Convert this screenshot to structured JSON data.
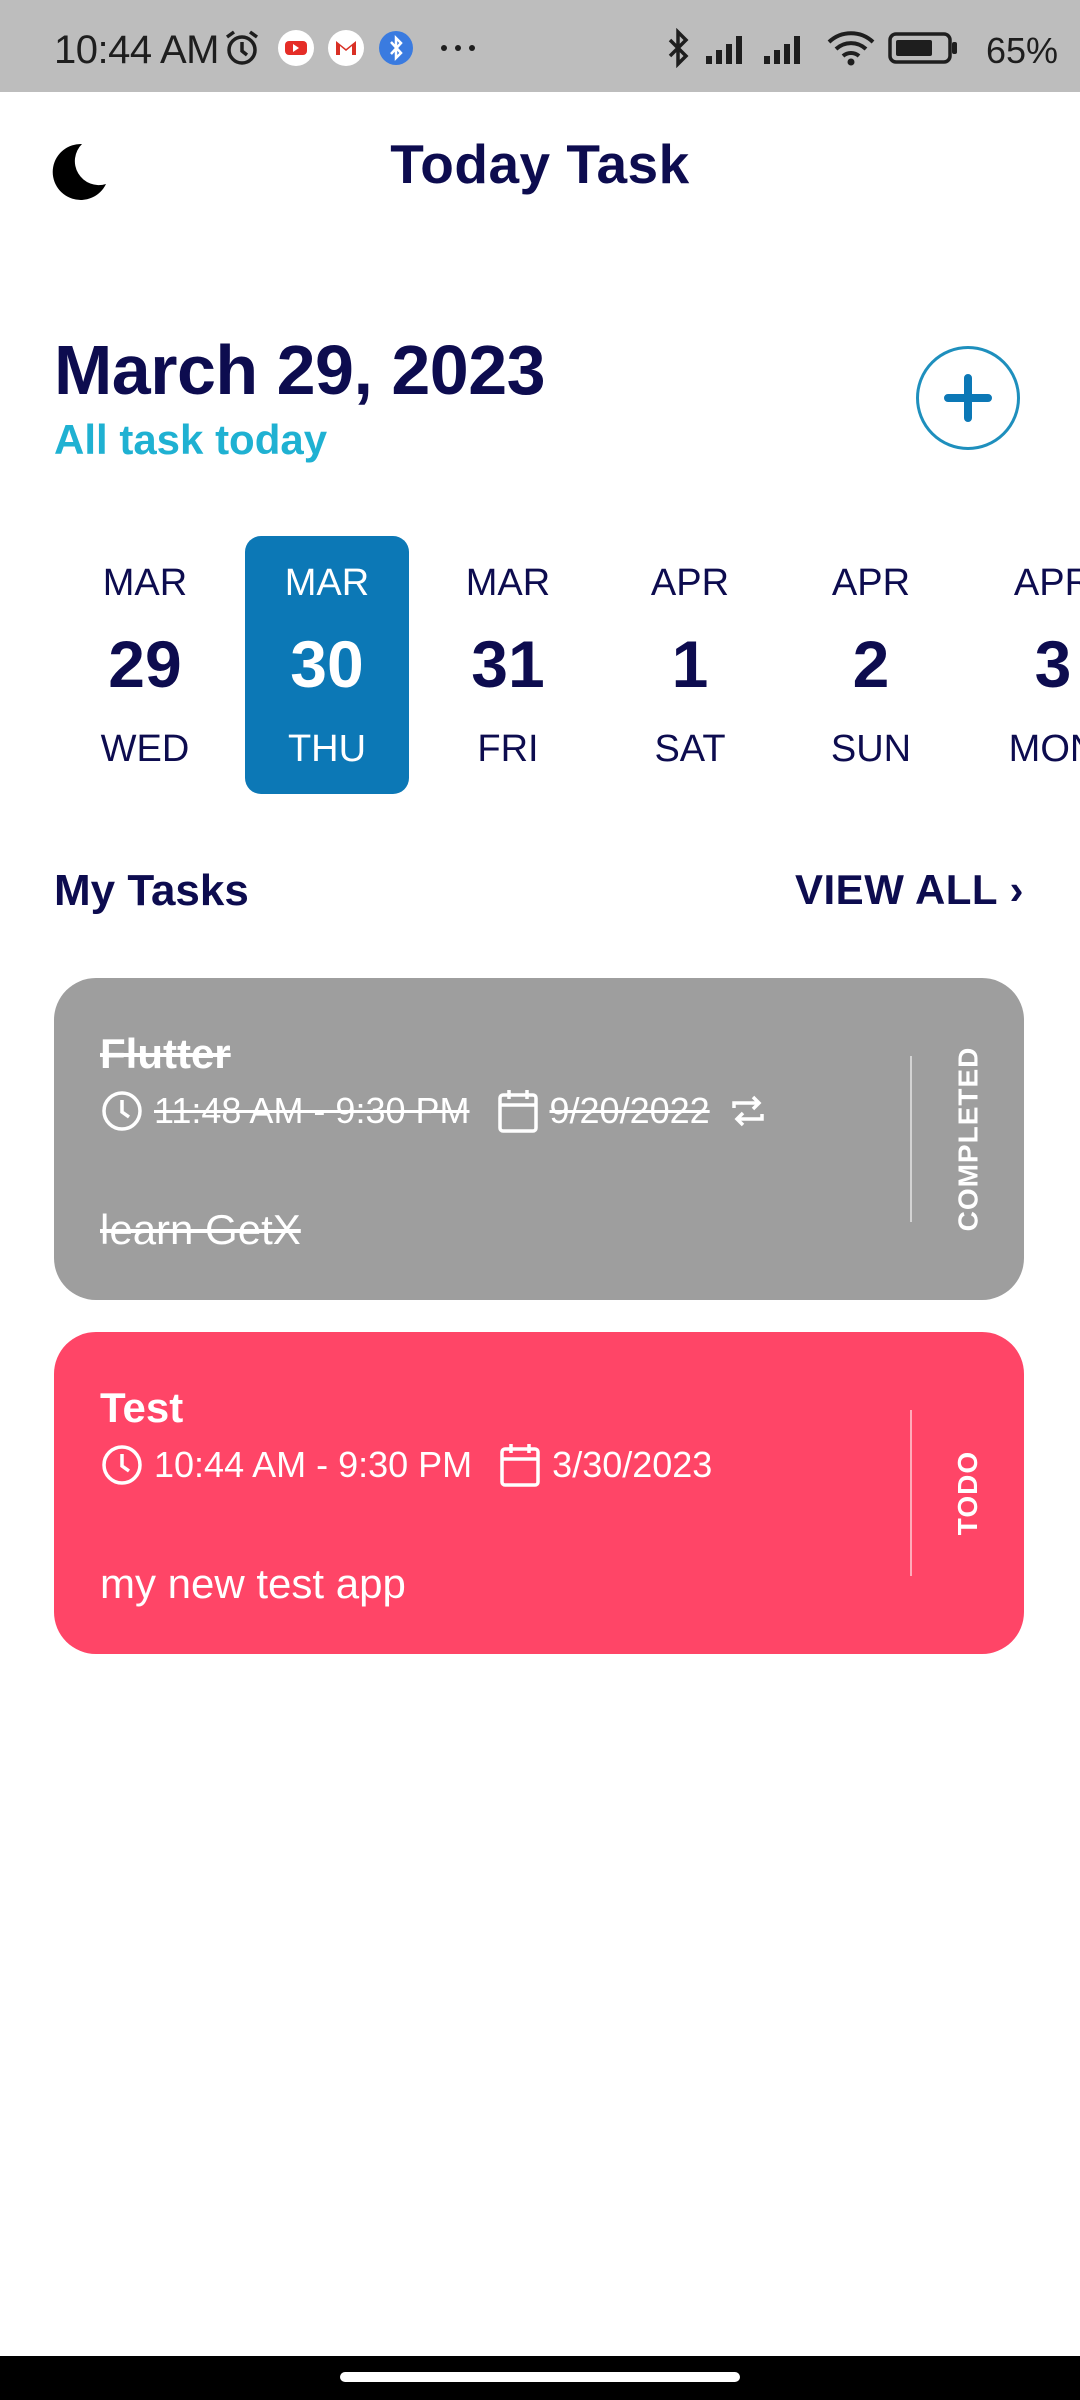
{
  "status_bar": {
    "time": "10:44 AM",
    "battery": "65%",
    "icons": [
      "alarm-icon",
      "youtube-icon",
      "gmail-icon",
      "bluetooth-app-icon",
      "more-icon",
      "bluetooth-icon",
      "signal-icon",
      "signal-icon",
      "wifi-icon",
      "battery-icon"
    ]
  },
  "header": {
    "title": "Today Task",
    "theme_icon": "moon-icon"
  },
  "date_header": {
    "date": "March 29, 2023",
    "subtitle": "All task today",
    "add_icon": "plus-icon"
  },
  "date_picker": {
    "selected_index": 1,
    "accent_color": "#0c78b6",
    "dates": [
      {
        "month": "MAR",
        "day": "29",
        "weekday": "WED"
      },
      {
        "month": "MAR",
        "day": "30",
        "weekday": "THU"
      },
      {
        "month": "MAR",
        "day": "31",
        "weekday": "FRI"
      },
      {
        "month": "APR",
        "day": "1",
        "weekday": "SAT"
      },
      {
        "month": "APR",
        "day": "2",
        "weekday": "SUN"
      },
      {
        "month": "APR",
        "day": "3",
        "weekday": "MON"
      }
    ]
  },
  "tasks_section": {
    "title": "My Tasks",
    "view_all": "VIEW ALL ›"
  },
  "tasks": [
    {
      "title": "Flutter",
      "time": "11:48 AM - 9:30 PM",
      "date": "9/20/2022",
      "note": "learn GetX",
      "status": "COMPLETED",
      "color": "#9e9e9e",
      "repeat": true
    },
    {
      "title": "Test",
      "time": "10:44 AM - 9:30 PM",
      "date": "3/30/2023",
      "note": "my new test app",
      "status": "TODO",
      "color": "#ff4567",
      "repeat": false
    }
  ]
}
